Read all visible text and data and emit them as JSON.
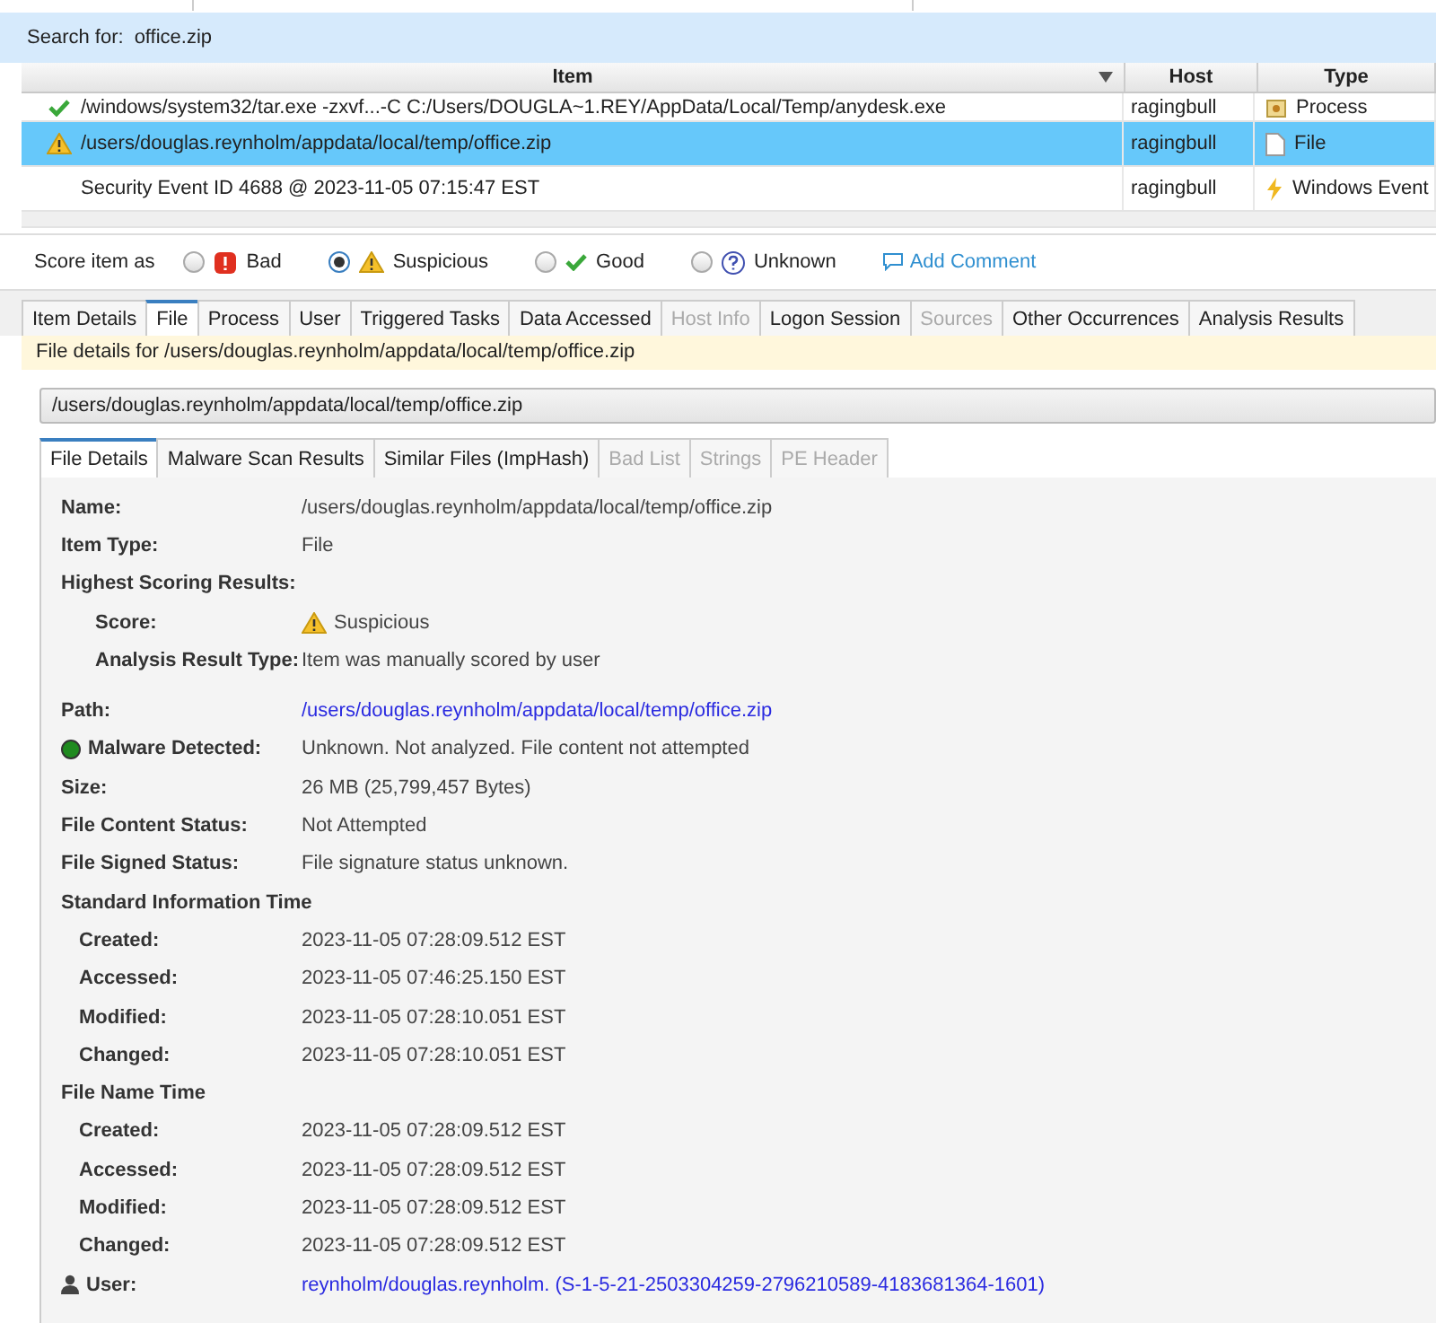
{
  "search": {
    "label": "Search for:",
    "value": "office.zip"
  },
  "table": {
    "columns": [
      "Item",
      "Host",
      "Type"
    ],
    "rows": [
      {
        "item": "/windows/system32/tar.exe -zxvf...-C C:/Users/DOUGLA~1.REY/AppData/Local/Temp/anydesk.exe",
        "host": "ragingbull",
        "type": "Process",
        "kind": "good",
        "selected": false
      },
      {
        "item": "/users/douglas.reynholm/appdata/local/temp/office.zip",
        "host": "ragingbull",
        "type": "File",
        "kind": "suspicious",
        "selected": true
      },
      {
        "item": "Security Event ID 4688 @ 2023-11-05 07:15:47 EST",
        "host": "ragingbull",
        "type": "Windows Event",
        "kind": "plain",
        "selected": false
      }
    ]
  },
  "score_bar": {
    "label": "Score item as",
    "options": [
      {
        "label": "Bad",
        "kind": "bad",
        "selected": false
      },
      {
        "label": "Suspicious",
        "kind": "suspicious",
        "selected": true
      },
      {
        "label": "Good",
        "kind": "good",
        "selected": false
      },
      {
        "label": "Unknown",
        "kind": "unknown",
        "selected": false
      }
    ],
    "comment_link": "Add Comment"
  },
  "tabs": [
    {
      "label": "Item Details",
      "selected": false,
      "disabled": false
    },
    {
      "label": "File",
      "selected": true,
      "disabled": false
    },
    {
      "label": "Process",
      "selected": false,
      "disabled": false
    },
    {
      "label": "User",
      "selected": false,
      "disabled": false
    },
    {
      "label": "Triggered Tasks",
      "selected": false,
      "disabled": false
    },
    {
      "label": "Data Accessed",
      "selected": false,
      "disabled": false
    },
    {
      "label": "Host Info",
      "selected": false,
      "disabled": true
    },
    {
      "label": "Logon Session",
      "selected": false,
      "disabled": false
    },
    {
      "label": "Sources",
      "selected": false,
      "disabled": true
    },
    {
      "label": "Other Occurrences",
      "selected": false,
      "disabled": false
    },
    {
      "label": "Analysis Results",
      "selected": false,
      "disabled": false
    }
  ],
  "info_bar": "File details for /users/douglas.reynholm/appdata/local/temp/office.zip",
  "path_bar": "/users/douglas.reynholm/appdata/local/temp/office.zip",
  "sub_tabs": [
    {
      "label": "File Details",
      "selected": true,
      "disabled": false
    },
    {
      "label": "Malware Scan Results",
      "selected": false,
      "disabled": false
    },
    {
      "label": "Similar Files (ImpHash)",
      "selected": false,
      "disabled": false
    },
    {
      "label": "Bad List",
      "selected": false,
      "disabled": true
    },
    {
      "label": "Strings",
      "selected": false,
      "disabled": true
    },
    {
      "label": "PE Header",
      "selected": false,
      "disabled": true
    }
  ],
  "details": [
    {
      "kind": "field",
      "label": "Name:",
      "value": "/users/douglas.reynholm/appdata/local/temp/office.zip"
    },
    {
      "kind": "field",
      "label": "Item Type:",
      "value": "File"
    },
    {
      "kind": "heading",
      "label": "Highest Scoring Results:"
    },
    {
      "kind": "score",
      "label": "Score:",
      "value": "Suspicious"
    },
    {
      "kind": "sub",
      "label": "Analysis Result Type:",
      "value": "Item was manually scored by user"
    },
    {
      "kind": "gap"
    },
    {
      "kind": "link",
      "label": "Path:",
      "value": "/users/douglas.reynholm/appdata/local/temp/office.zip"
    },
    {
      "kind": "status",
      "label": "Malware Detected:",
      "value": "Unknown. Not analyzed. File content not attempted"
    },
    {
      "kind": "field",
      "label": "Size:",
      "value": "26 MB (25,799,457 Bytes)"
    },
    {
      "kind": "field",
      "label": "File Content Status:",
      "value": "Not Attempted"
    },
    {
      "kind": "field",
      "label": "File Signed Status:",
      "value": "File signature status unknown."
    },
    {
      "kind": "heading",
      "label": "Standard Information Time"
    },
    {
      "kind": "time",
      "label": "Created:",
      "value": "2023-11-05 07:28:09.512 EST"
    },
    {
      "kind": "time",
      "label": "Accessed:",
      "value": "2023-11-05 07:46:25.150 EST"
    },
    {
      "kind": "time",
      "label": "Modified:",
      "value": "2023-11-05 07:28:10.051 EST"
    },
    {
      "kind": "time",
      "label": "Changed:",
      "value": "2023-11-05 07:28:10.051 EST"
    },
    {
      "kind": "heading",
      "label": "File Name Time"
    },
    {
      "kind": "time",
      "label": "Created:",
      "value": "2023-11-05 07:28:09.512 EST"
    },
    {
      "kind": "time",
      "label": "Accessed:",
      "value": "2023-11-05 07:28:09.512 EST"
    },
    {
      "kind": "time",
      "label": "Modified:",
      "value": "2023-11-05 07:28:09.512 EST"
    },
    {
      "kind": "time",
      "label": "Changed:",
      "value": "2023-11-05 07:28:09.512 EST"
    },
    {
      "kind": "user",
      "label": "User:",
      "value": "reynholm/douglas.reynholm. (S-1-5-21-2503304259-2796210589-4183681364-1601)"
    }
  ]
}
